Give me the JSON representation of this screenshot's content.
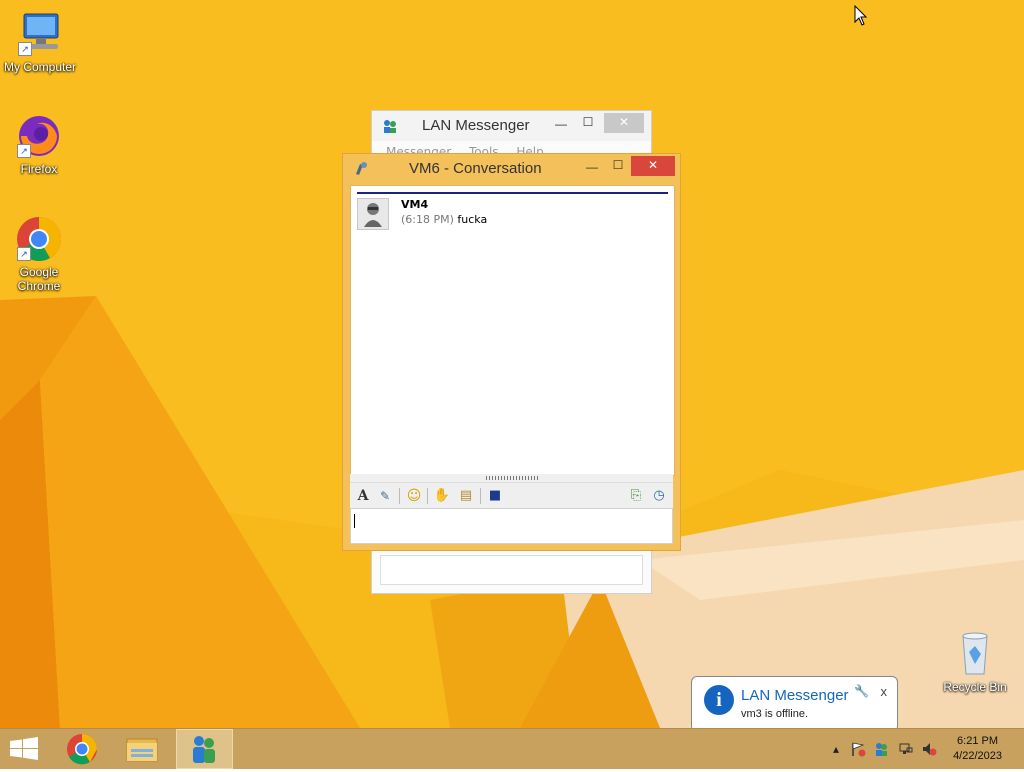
{
  "desktop": {
    "icons": [
      {
        "label": "My Computer"
      },
      {
        "label": "Firefox"
      },
      {
        "label": "Google Chrome",
        "line1": "Google",
        "line2": "Chrome"
      },
      {
        "label": "Recycle Bin"
      }
    ]
  },
  "back_window": {
    "title": "LAN Messenger",
    "menu": [
      "Messenger",
      "Tools",
      "Help"
    ]
  },
  "conversation_window": {
    "title": "VM6 - Conversation",
    "messages": [
      {
        "sender": "VM4",
        "time": "(6:18 PM)",
        "text": "fucka"
      }
    ],
    "input_value": ""
  },
  "notification": {
    "title": "LAN Messenger",
    "body": "vm3 is offline.",
    "close_glyph": "x"
  },
  "taskbar": {
    "apps": [
      "Google Chrome",
      "File Explorer",
      "LAN Messenger"
    ],
    "clock_time": "6:21 PM",
    "clock_date": "4/22/2023"
  },
  "colors": {
    "desktop_bg": "#f7b81a",
    "window_frame": "#f4c05a",
    "close_button": "#d9463b",
    "taskbar": "#c9a15e",
    "info_blue": "#1565c0"
  }
}
